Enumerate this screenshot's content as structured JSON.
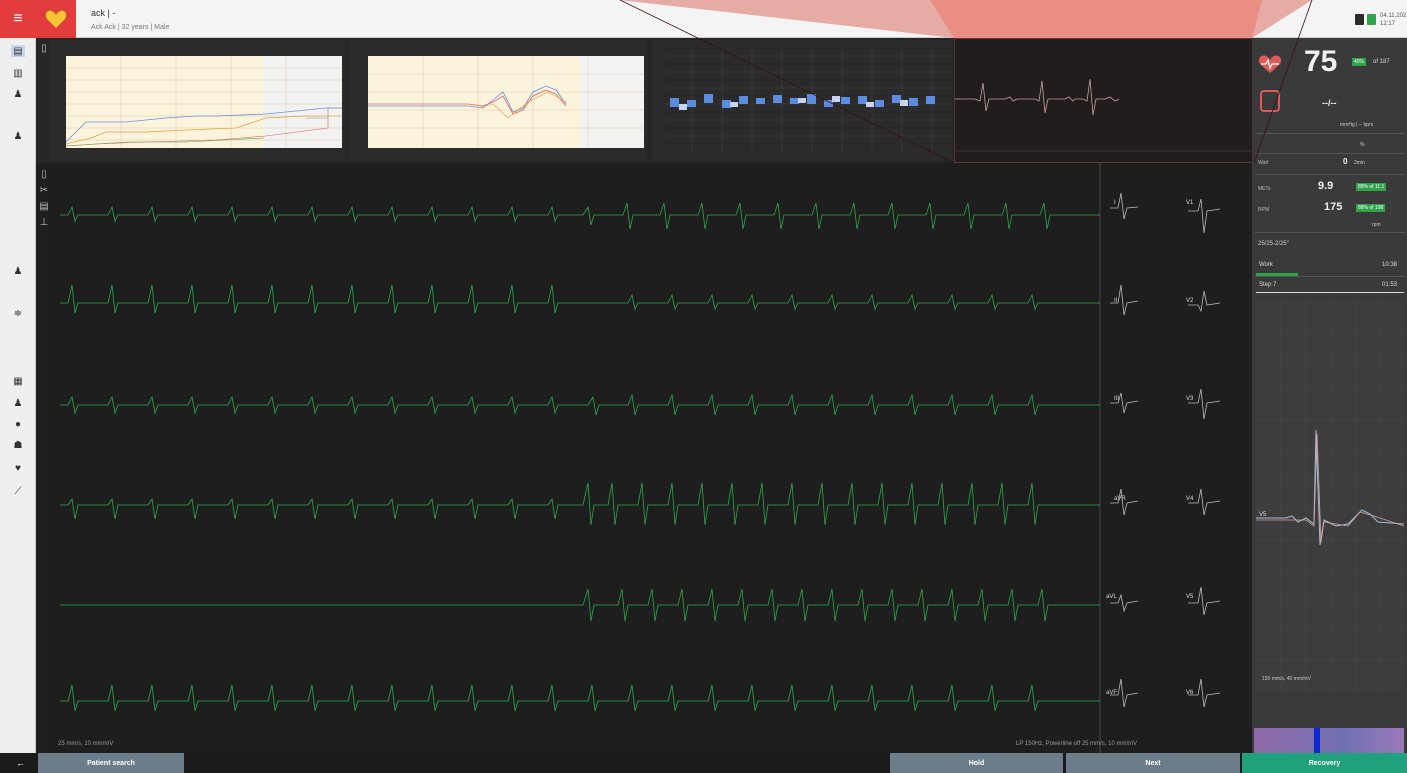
{
  "topbar": {
    "menu_icon": "menu-icon",
    "logo_icon": "heart-icon",
    "patient_name": "ack | -",
    "patient_info": "Ack Ack | 32 years | Male",
    "date": "04.11.202",
    "time": "12:17"
  },
  "ecg": {
    "leads_left": [
      "I",
      "II",
      "III",
      "aVR",
      "aVL",
      "aVF"
    ],
    "leads_right": [
      "V1",
      "V2",
      "V3",
      "V4",
      "V5",
      "V6"
    ],
    "footer_left": "25 mm/s, 10 mm/mV",
    "footer_right": "LP 150Hz, Powerline off   25 mm/s, 10 mm/mV"
  },
  "vitals": {
    "hr": "75",
    "hr_badge": "40%",
    "hr_of": "of 187",
    "bp": "--/--",
    "bp_unit": "mmHg | -- bpm",
    "spo2_unit": "%",
    "watt_label": "Watt",
    "watt_value": "0",
    "watt_unit": "2min",
    "mets_label": "METs",
    "mets_value": "9.9",
    "mets_badge": "89% of 11.1",
    "rpm_label": "RPM",
    "rpm_value": "175",
    "rpm_badge": "88% of 198",
    "rpm_unit": "rpm",
    "protocol": "25/25-2/25\"",
    "work_label": "Work",
    "work_time": "10:38",
    "step_label": "Step 7",
    "step_time": "01:53",
    "strip_lead": "V5",
    "strip_speed": "150 mm/s, 40 mm/mV"
  },
  "bottombar": {
    "back_icon": "arrow-left-icon",
    "patient_search": "Patient search",
    "hold": "Hold",
    "next": "Next",
    "recovery": "Recovery",
    "hold_key": "F",
    "next_key": "F",
    "recovery_key": "F1"
  },
  "colors": {
    "accent_red": "#e23c3c",
    "ecg_green": "#2ea84a",
    "status_green": "#2fa24a",
    "recovery_teal": "#21a07c",
    "bar_blue": "#5a8ce0"
  }
}
